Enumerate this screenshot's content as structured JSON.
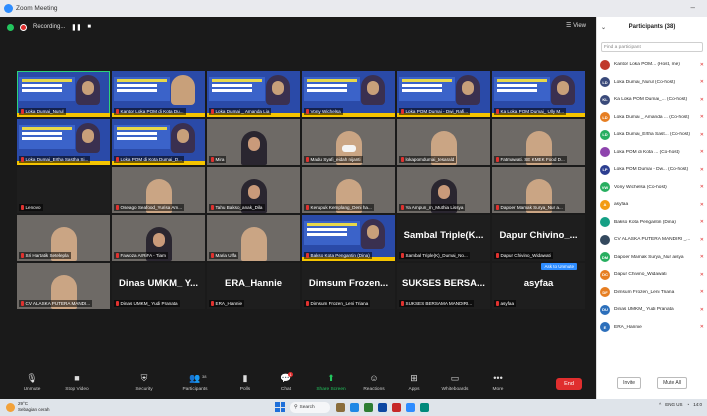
{
  "window": {
    "title": "Zoom Meeting",
    "minimize": "–"
  },
  "topbar": {
    "recording": "Recording...",
    "pause": "❚❚",
    "stop": "■",
    "view": "☰ View"
  },
  "tiles": [
    {
      "type": "slide",
      "name": "Loka Dumai_Nurul",
      "face": "hijab",
      "hl": true
    },
    {
      "type": "slide",
      "name": "Kantor Loka POM di Kota Du...",
      "face": "plain"
    },
    {
      "type": "slide",
      "name": "Loka Dumai _ Amanda Lia",
      "face": "hijab"
    },
    {
      "type": "slide",
      "name": "Vony Wichelsa",
      "face": "hijab"
    },
    {
      "type": "slide",
      "name": "Loka POM Dumai - Dwi_Rafi...",
      "face": "hijab"
    },
    {
      "type": "slide",
      "name": "Ka Loka POM Dumai_ Ully M...",
      "face": "hijab"
    },
    {
      "type": "slide",
      "name": "Loka Dumai_Ertha Sastha Si...",
      "face": "hijab"
    },
    {
      "type": "slide",
      "name": "Loka POM di Kota Dumai_D...",
      "face": "hijab"
    },
    {
      "type": "video",
      "name": "Mira",
      "person": "dark"
    },
    {
      "type": "video",
      "name": "Madu Syafi_eidah nijanti",
      "person": "mask"
    },
    {
      "type": "video",
      "name": "lokapomdumai_tesarald",
      "person": "plain"
    },
    {
      "type": "video",
      "name": "Fatmawati. SE KMEK Food D...",
      "person": "plain"
    },
    {
      "type": "blank",
      "name": "Lenovo"
    },
    {
      "type": "video",
      "name": "Oseago Seafood_Yurisa Am...",
      "person": "plain"
    },
    {
      "type": "video",
      "name": "Tahu Bakso_anak_Dila",
      "person": "dark"
    },
    {
      "type": "video",
      "name": "Kerupuk Kemplang_Deni ha...",
      "person": "plain"
    },
    {
      "type": "video",
      "name": "Ya Ampun_m_Muthia Lissya",
      "person": "dark"
    },
    {
      "type": "video",
      "name": "Dapoer Mamak Surya_Nur a...",
      "person": "plain"
    },
    {
      "type": "video",
      "name": "Sri Hartatik Setelepla",
      "person": "plain"
    },
    {
      "type": "video",
      "name": "Fawoza ArRiFA - Tiam",
      "person": "dark"
    },
    {
      "type": "video",
      "name": "Maria Ulfa",
      "person": "plain"
    },
    {
      "type": "slide",
      "name": "Bakso Kota Pengantin (Dina)",
      "face": "hijab"
    },
    {
      "type": "text",
      "name": "Sambal Triple(K)_Dumai_No...",
      "big": "Sambal Triple(K..."
    },
    {
      "type": "text",
      "name": "Dapur Chivino_Widawati",
      "big": "Dapur Chivino_..."
    },
    {
      "type": "video",
      "name": "CV ALASKA PUTERA MANDI...",
      "person": "plain"
    },
    {
      "type": "text",
      "name": "Dinas UMKM_ Yudi Pranata",
      "big": "Dinas UMKM_ Y..."
    },
    {
      "type": "text",
      "name": "ERA_Hannie",
      "big": "ERA_Hannie"
    },
    {
      "type": "text",
      "name": "Dimsum Frozen_Leni Triana",
      "big": "Dimsum Frozen..."
    },
    {
      "type": "text",
      "name": "SUKSES BERSAMA MANDIRI...",
      "big": "SUKSES BERSA..."
    },
    {
      "type": "text",
      "name": "asyfaa",
      "big": "asyfaa",
      "atu": "Ask to Unmute"
    }
  ],
  "slide_lines": [
    "KOMENDAGAR",
    "CARA PRODUKSI",
    "YANG BAIK"
  ],
  "toolbar": {
    "unmute": "Unmute",
    "stop_video": "Stop Video",
    "security": "Security",
    "participants": "Participants",
    "participants_count": "38",
    "polls": "Polls",
    "chat": "Chat",
    "chat_badge": "1",
    "share": "Share Screen",
    "reactions": "Reactions",
    "apps": "Apps",
    "whiteboards": "Whiteboards",
    "more": "More",
    "end": "End"
  },
  "panel": {
    "title": "Participants (38)",
    "search_placeholder": "Find a participant",
    "invite": "Invite",
    "mute_all": "Mute All",
    "participants": [
      {
        "init": "",
        "name": "Kantor Loka POM... (Host, me)",
        "color": "#c0392b"
      },
      {
        "init": "LD",
        "name": "Loka Dumai_Nurul (Co-host)",
        "color": "#3a4a7a"
      },
      {
        "init": "KL",
        "name": "Ka Loka POM Dumai_... (Co-host)",
        "color": "#3a4a7a"
      },
      {
        "init": "LD",
        "name": "Loka Dumai _ Amanda ... (Co-host)",
        "color": "#e67e22"
      },
      {
        "init": "LD",
        "name": "Loka Dumai_Ertha Sast... (Co-host)",
        "color": "#27ae60"
      },
      {
        "init": "",
        "name": "Loka POM di Kota ... (Co-host)",
        "color": "#8e44ad"
      },
      {
        "init": "LP",
        "name": "Loka POM Dumai - Dw... (Co-host)",
        "color": "#2c3e90"
      },
      {
        "init": "VW",
        "name": "Vony Wichelsa (Co-host)",
        "color": "#27ae60"
      },
      {
        "init": "A",
        "name": "asyfaa",
        "color": "#f39c12"
      },
      {
        "init": "",
        "name": "Bakso Kota Pengantin (Dina)",
        "color": "#16a085"
      },
      {
        "init": "",
        "name": "CV ALASKA PUTERA MANDIRI _...",
        "color": "#34495e"
      },
      {
        "init": "DM",
        "name": "Dapoer Mamak Surya_Nur aisya",
        "color": "#27ae60"
      },
      {
        "init": "DC",
        "name": "Dapur Chivino_Widawati",
        "color": "#e67e22"
      },
      {
        "init": "DF",
        "name": "Dimsum Frozen_Leni Triana",
        "color": "#e67e22"
      },
      {
        "init": "DU",
        "name": "Dinas UMKM_ Yudi Pranata",
        "color": "#2c6fbb"
      },
      {
        "init": "E",
        "name": "ERA_Hannie",
        "color": "#2c6fbb"
      }
    ]
  },
  "taskbar": {
    "temp": "29°C",
    "weather": "Sebagian cerah",
    "search": "Search",
    "lang": "ENG",
    "region": "US",
    "time": "14:0"
  }
}
